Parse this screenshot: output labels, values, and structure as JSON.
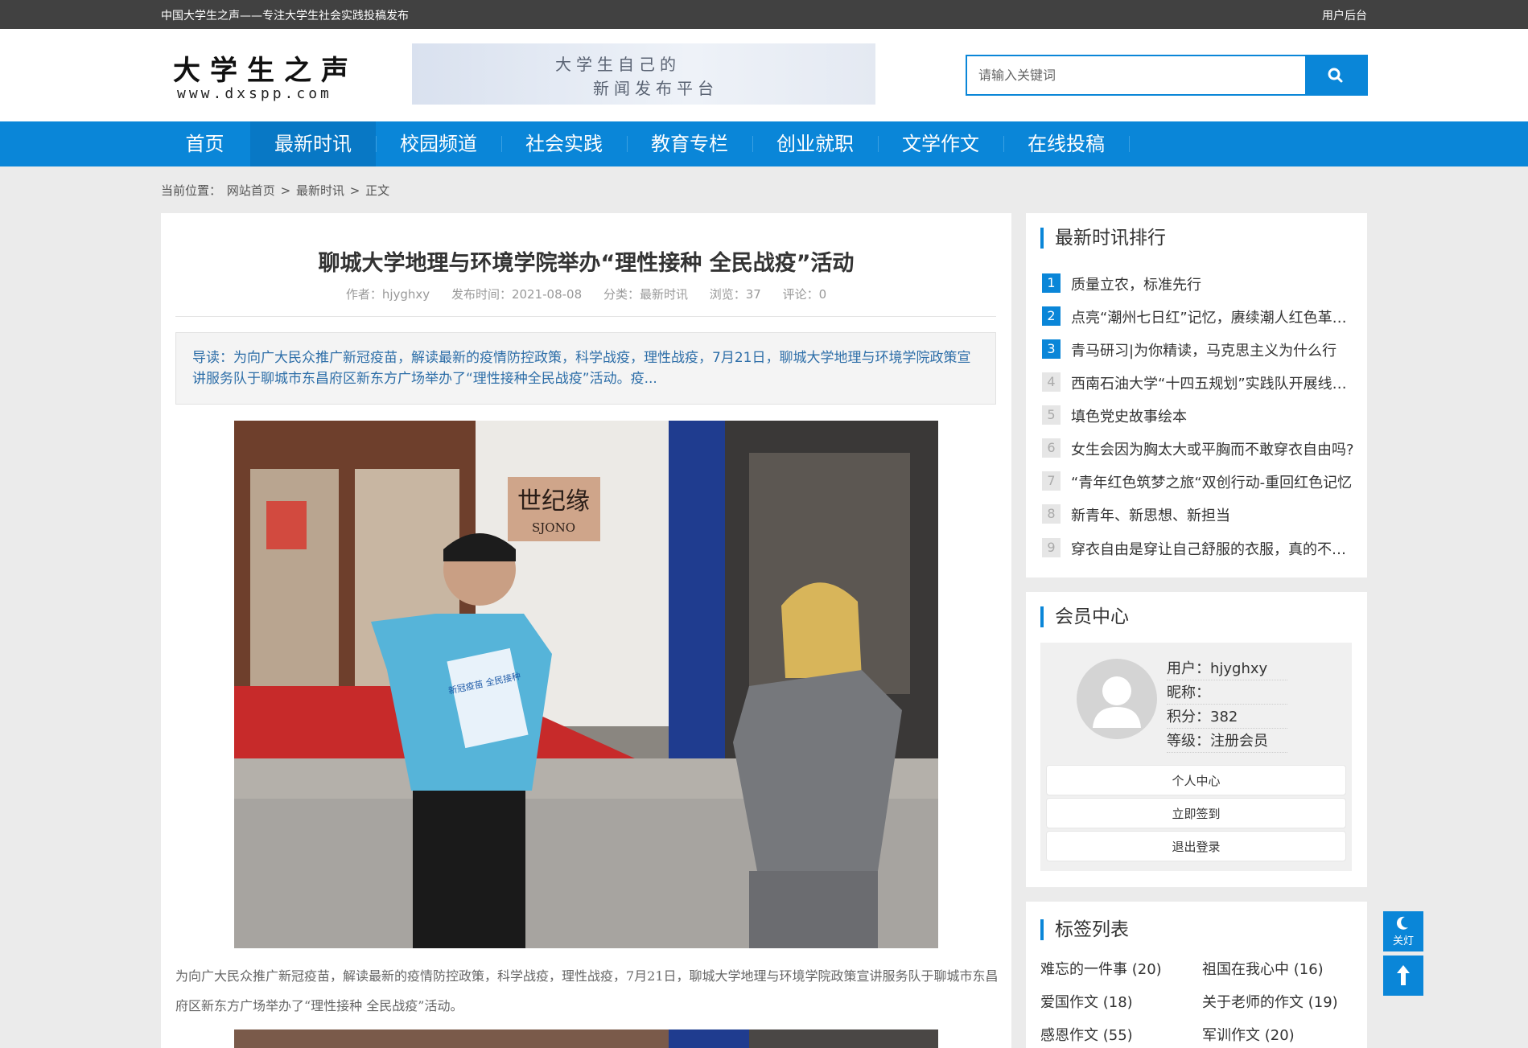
{
  "topbar": {
    "slogan": "中国大学生之声——专注大学生社会实践投稿发布",
    "user_link": "用户后台"
  },
  "header": {
    "logo_cn": "大学生之声",
    "logo_en": "www.dxspp.com",
    "banner_line1": "大学生自己的",
    "banner_line2": "新闻发布平台",
    "search_placeholder": "请输入关键词",
    "search_icon": "search-icon"
  },
  "nav": {
    "items": [
      "首页",
      "最新时讯",
      "校园频道",
      "社会实践",
      "教育专栏",
      "创业就职",
      "文学作文",
      "在线投稿"
    ],
    "active": "最新时讯"
  },
  "breadcrumb": {
    "label": "当前位置：",
    "home": "网站首页",
    "sep": ">",
    "category": "最新时讯",
    "current": "正文"
  },
  "article": {
    "title": "聊城大学地理与环境学院举办“理性接种 全民战疫”活动",
    "author": "作者：hjyghxy",
    "date": "发布时间：2021-08-08",
    "category": "分类：最新时讯",
    "views": "浏览：37",
    "comments": "评论：0",
    "lead": "导读：为向广大民众推广新冠疫苗，解读最新的疫情防控政策，科学战疫，理性战疫，7月21日，聊城大学地理与环境学院政策宣讲服务队于聊城市东昌府区新东方广场举办了“理性接种全民战疫”活动。疫...",
    "photo_sign_cn": "世纪缘",
    "photo_sign_en": "SJONO",
    "photo_poster": "新冠疫苗 全民接种",
    "paragraph": "为向广大民众推广新冠疫苗，解读最新的疫情防控政策，科学战疫，理性战疫，7月21日，聊城大学地理与环境学院政策宣讲服务队于聊城市东昌府区新东方广场举办了“理性接种 全民战疫”活动。"
  },
  "ranking": {
    "title": "最新时讯排行",
    "items": [
      {
        "n": "1",
        "t": "质量立农，标准先行"
      },
      {
        "n": "2",
        "t": "点亮“潮州七日红”记忆，赓续潮人红色革命精神"
      },
      {
        "n": "3",
        "t": "青马研习|为你精读，马克思主义为什么行"
      },
      {
        "n": "4",
        "t": "西南石油大学“十四五规划”实践队开展线上宣讲"
      },
      {
        "n": "5",
        "t": "填色党史故事绘本"
      },
      {
        "n": "6",
        "t": "女生会因为胸太大或平胸而不敢穿衣自由吗?"
      },
      {
        "n": "7",
        "t": "“青年红色筑梦之旅“双创行动-重回红色记忆"
      },
      {
        "n": "8",
        "t": "新青年、新思想、新担当"
      },
      {
        "n": "9",
        "t": "穿衣自由是穿让自己舒服的衣服，真的不明白吗"
      }
    ]
  },
  "member": {
    "title": "会员中心",
    "user": "用户：hjyghxy",
    "nickname": "昵称：",
    "points": "积分：382",
    "level": "等级：注册会员",
    "buttons": [
      "个人中心",
      "立即签到",
      "退出登录"
    ]
  },
  "tags": {
    "title": "标签列表",
    "items": [
      "难忘的一件事 (20)",
      "祖国在我心中 (16)",
      "爱国作文 (18)",
      "关于老师的作文 (19)",
      "感恩作文 (55)",
      "军训作文 (20)"
    ]
  },
  "float": {
    "night_label": "关灯",
    "night_icon": "moon-icon",
    "top_icon": "arrow-up-icon"
  },
  "colors": {
    "accent": "#0a86d8",
    "topbar": "#414141",
    "background": "#ebebeb"
  }
}
